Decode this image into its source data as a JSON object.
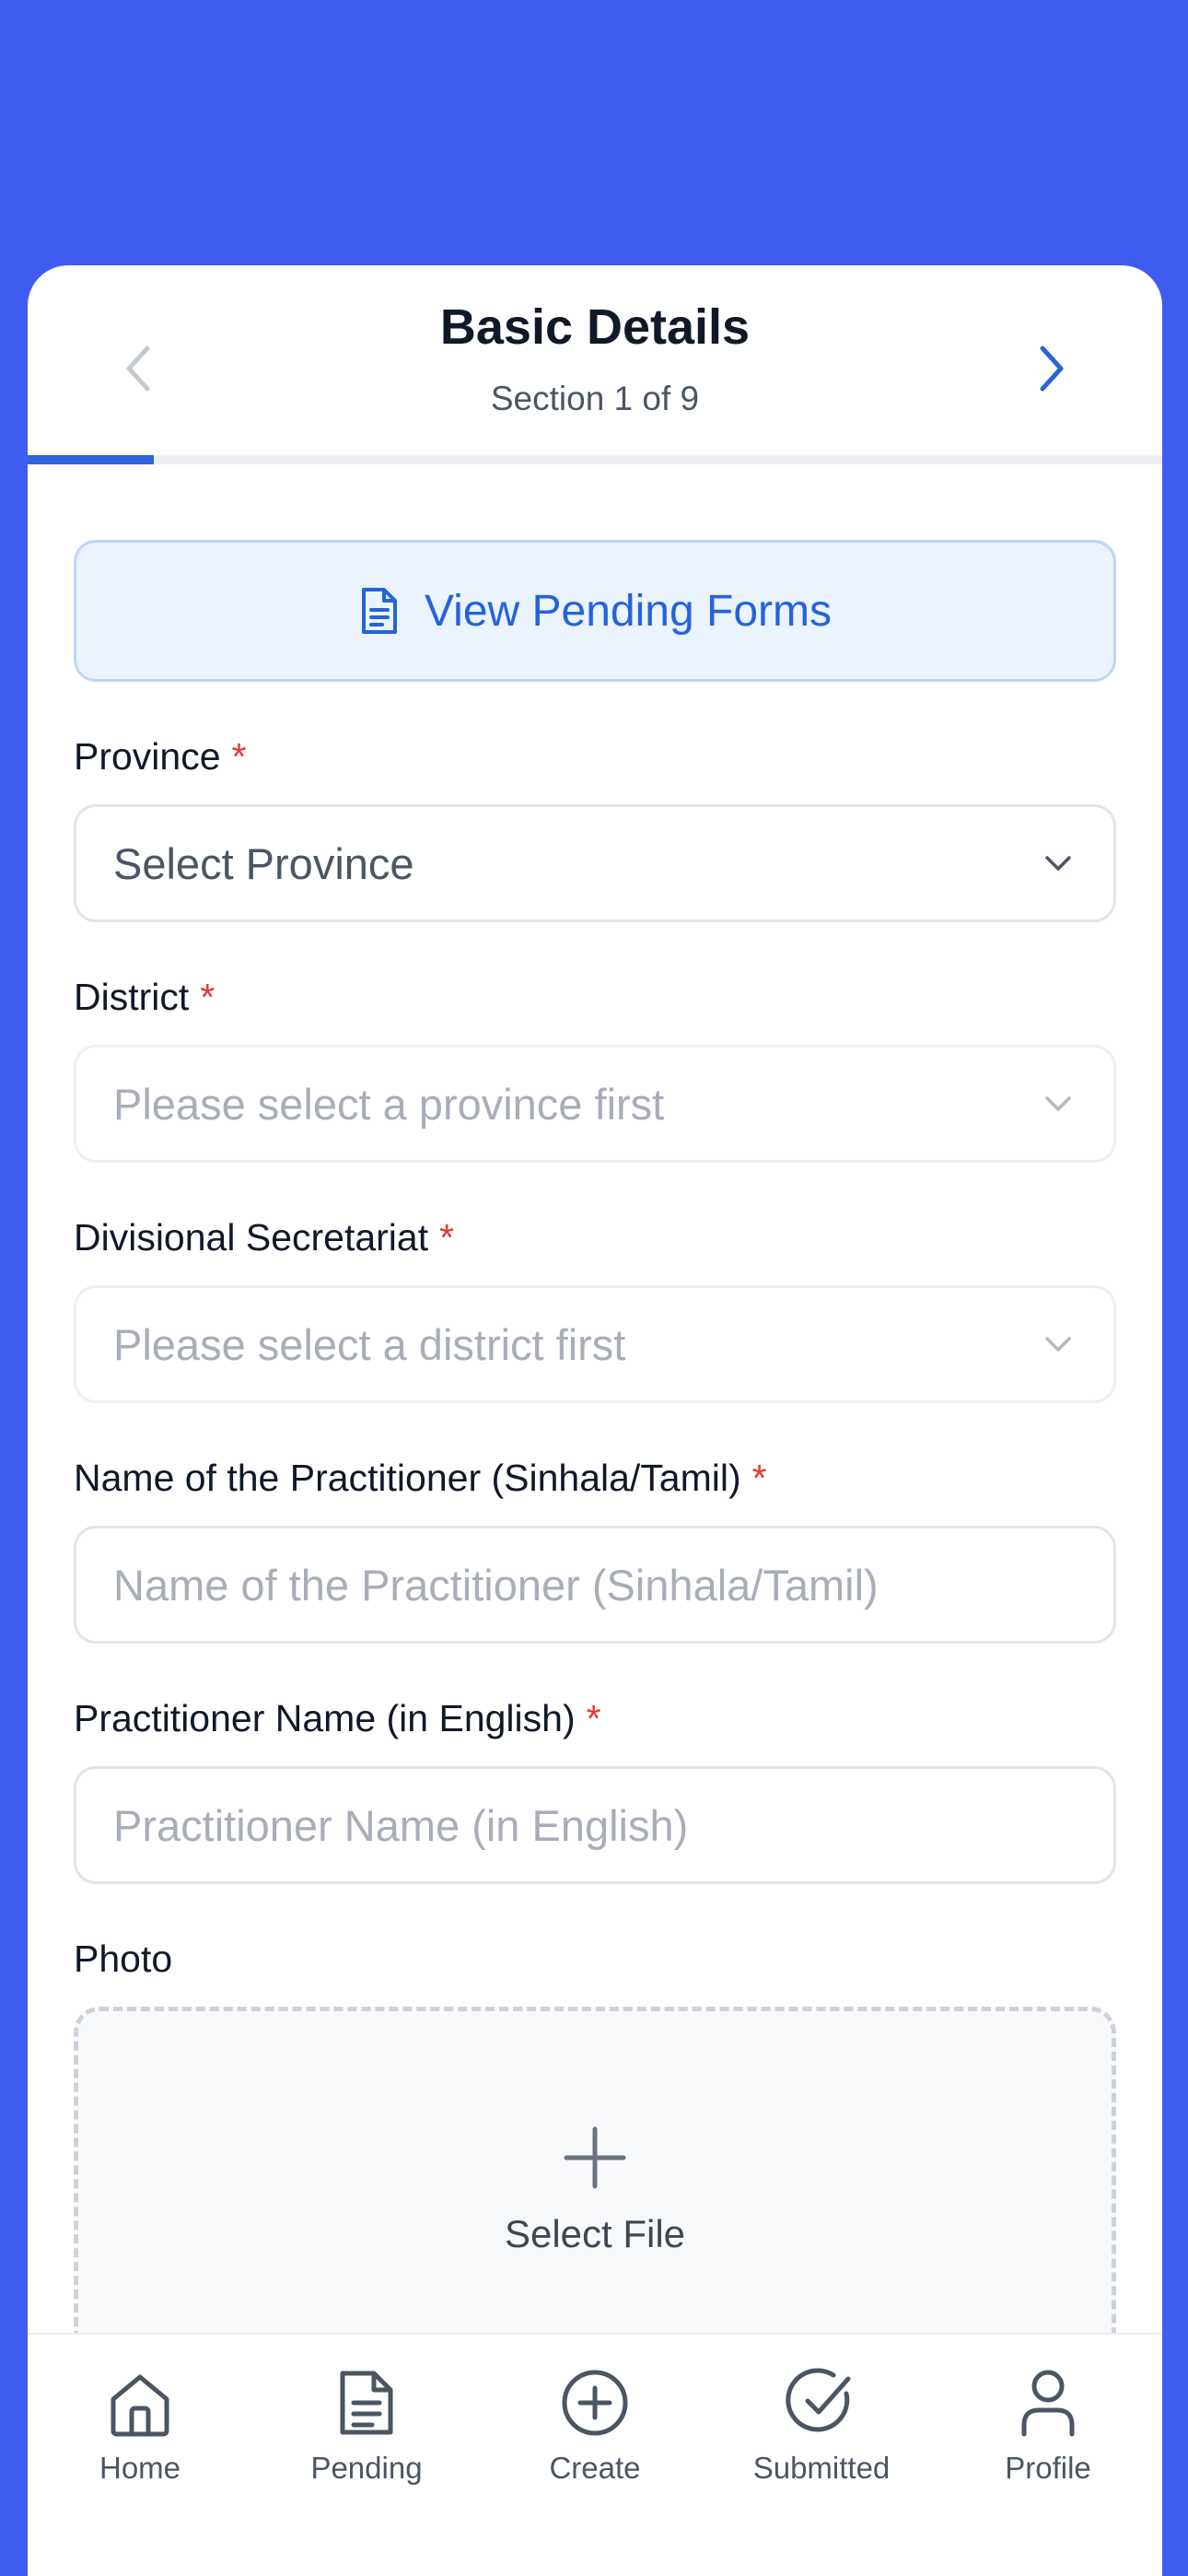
{
  "header": {
    "title": "Basic Details",
    "subtitle": "Section 1 of 9",
    "progress": 0.1111
  },
  "pending_button": {
    "label": "View Pending Forms",
    "icon": "document-icon"
  },
  "fields": {
    "province": {
      "label": "Province",
      "required": "*",
      "value": "Select Province"
    },
    "district": {
      "label": "District",
      "required": "*",
      "placeholder": "Please select a province first"
    },
    "divisional": {
      "label": "Divisional Secretariat",
      "required": "*",
      "placeholder": "Please select a district first"
    },
    "name_local": {
      "label": "Name of the Practitioner (Sinhala/Tamil)",
      "required": "*",
      "placeholder": "Name of the Practitioner (Sinhala/Tamil)"
    },
    "name_english": {
      "label": "Practitioner Name (in English)",
      "required": "*",
      "placeholder": "Practitioner Name (in English)"
    },
    "photo": {
      "label": "Photo",
      "button": "Select File"
    }
  },
  "tabs": [
    {
      "label": "Home",
      "icon": "home-icon"
    },
    {
      "label": "Pending",
      "icon": "document-icon"
    },
    {
      "label": "Create",
      "icon": "plus-circle-icon"
    },
    {
      "label": "Submitted",
      "icon": "check-circle-icon"
    },
    {
      "label": "Profile",
      "icon": "user-icon"
    }
  ],
  "colors": {
    "background": "#3f5cf0",
    "accent": "#2563d9",
    "required": "#e53935"
  }
}
